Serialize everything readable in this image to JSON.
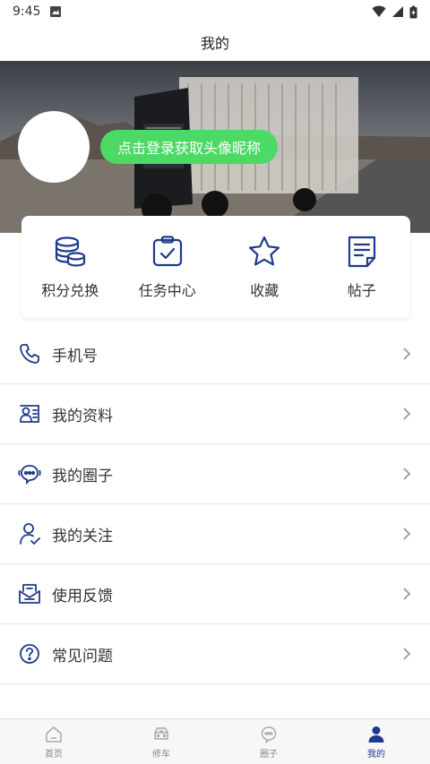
{
  "status_bar": {
    "time": "9:45"
  },
  "header": {
    "title": "我的"
  },
  "profile": {
    "login_label": "点击登录获取头像昵称"
  },
  "quick_actions": [
    {
      "label": "积分兑换",
      "icon": "coins-stack-icon"
    },
    {
      "label": "任务中心",
      "icon": "clipboard-check-icon"
    },
    {
      "label": "收藏",
      "icon": "star-icon"
    },
    {
      "label": "帖子",
      "icon": "document-icon"
    }
  ],
  "menu": [
    {
      "label": "手机号",
      "icon": "phone-icon"
    },
    {
      "label": "我的资料",
      "icon": "profile-card-icon"
    },
    {
      "label": "我的圈子",
      "icon": "chat-bubble-icon"
    },
    {
      "label": "我的关注",
      "icon": "user-check-icon"
    },
    {
      "label": "使用反馈",
      "icon": "mail-feedback-icon"
    },
    {
      "label": "常见问题",
      "icon": "question-circle-icon"
    }
  ],
  "tabs": [
    {
      "label": "首页",
      "icon": "home-icon",
      "active": false
    },
    {
      "label": "修车",
      "icon": "car-repair-icon",
      "active": false
    },
    {
      "label": "圈子",
      "icon": "chat-bubble-icon",
      "active": false
    },
    {
      "label": "我的",
      "icon": "user-icon",
      "active": true
    }
  ],
  "colors": {
    "accent": "#1e3a8a",
    "login_button": "#4cd964"
  }
}
